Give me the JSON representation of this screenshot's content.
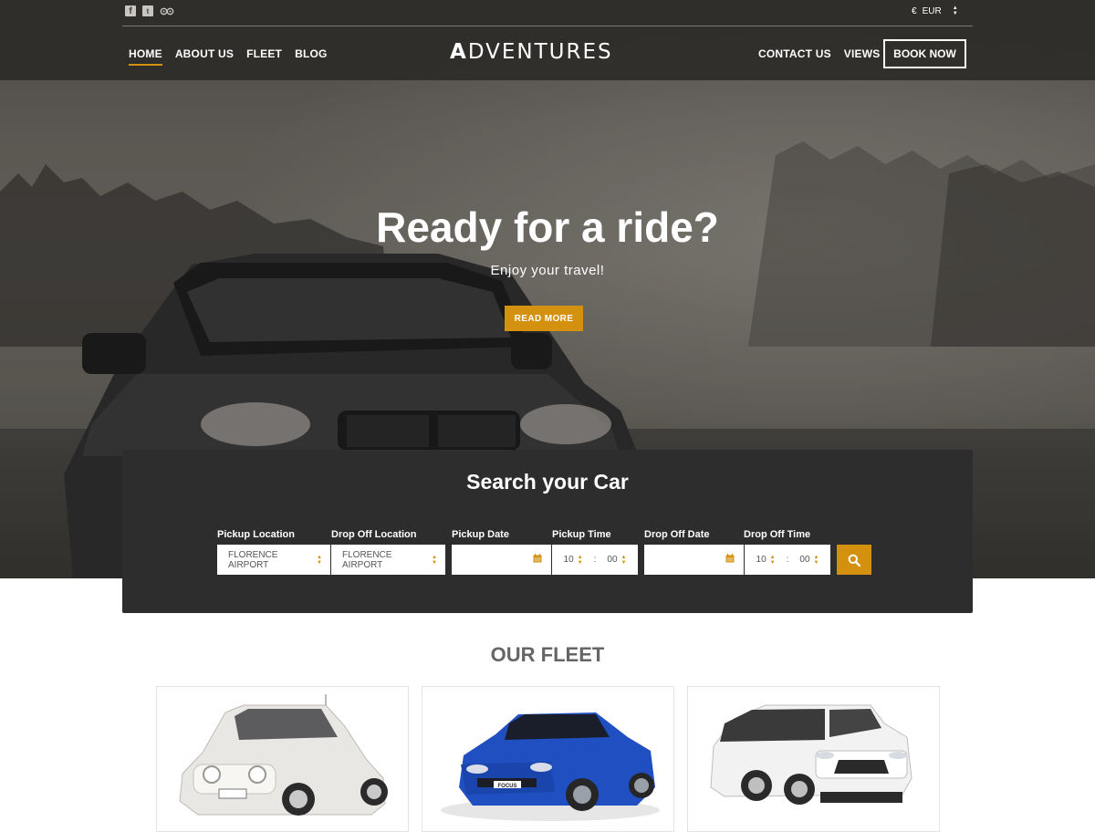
{
  "header": {
    "social_icons": [
      "facebook-icon",
      "twitter-icon",
      "tripadvisor-icon"
    ],
    "currency": {
      "symbol": "€",
      "code": "EUR"
    },
    "nav_left": [
      {
        "label": "HOME",
        "active": true
      },
      {
        "label": "ABOUT US"
      },
      {
        "label": "FLEET"
      },
      {
        "label": "BLOG"
      }
    ],
    "logo": {
      "first": "A",
      "rest": "DVENTURES"
    },
    "nav_right": [
      {
        "label": "CONTACT US"
      },
      {
        "label": "VIEWS"
      }
    ],
    "book_now": "BOOK NOW"
  },
  "hero": {
    "title": "Ready for a ride?",
    "subtitle": "Enjoy your travel!",
    "cta": "READ MORE"
  },
  "search": {
    "title": "Search your Car",
    "pickup_location": {
      "label": "Pickup Location",
      "value": "FLORENCE AIRPORT"
    },
    "dropoff_location": {
      "label": "Drop Off Location",
      "value": "FLORENCE AIRPORT"
    },
    "pickup_date": {
      "label": "Pickup Date",
      "value": ""
    },
    "pickup_time": {
      "label": "Pickup Time",
      "hour": "10",
      "minute": "00",
      "sep": ":"
    },
    "dropoff_date": {
      "label": "Drop Off Date",
      "value": ""
    },
    "dropoff_time": {
      "label": "Drop Off Time",
      "hour": "10",
      "minute": "00",
      "sep": ":"
    }
  },
  "fleet": {
    "title": "OUR FLEET",
    "cards": [
      {
        "image": "white-compact-car",
        "color": "#e9e7e3"
      },
      {
        "image": "blue-hatchback-car",
        "color": "#1f4fc1",
        "plate": "FOCUS"
      },
      {
        "image": "white-suv-car",
        "color": "#f2f2f2"
      }
    ]
  },
  "colors": {
    "accent": "#d4900f",
    "panel": "#2d2d2d",
    "header": "#2d2b28"
  }
}
